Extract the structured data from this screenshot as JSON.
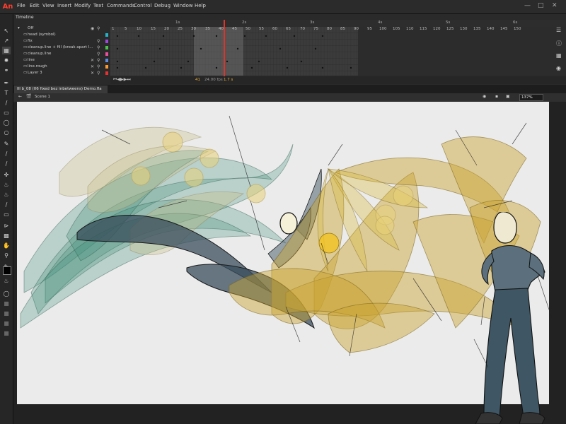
{
  "app": {
    "logo": "An"
  },
  "menu": [
    "File",
    "Edit",
    "View",
    "Insert",
    "Modify",
    "Text",
    "Commands",
    "Control",
    "Debug",
    "Window",
    "Help"
  ],
  "timeline": {
    "panel_title": "Timeline",
    "layers": [
      {
        "name": "Off"
      },
      {
        "name": "head (symbol)",
        "swatch": "#23b3c8"
      },
      {
        "name": "fix",
        "swatch": "#a046e0"
      },
      {
        "name": "cleanup.line + fill (break apart l...",
        "swatch": "#4cc34c"
      },
      {
        "name": "cleanup.line",
        "swatch": "#e84f9c"
      },
      {
        "name": "line",
        "swatch": "#5a8be0"
      },
      {
        "name": "line.rough",
        "swatch": "#ff9a2e"
      },
      {
        "name": "Layer 3",
        "swatch": "#e83030"
      }
    ],
    "frame_ticks": [
      "1",
      "5",
      "10",
      "15",
      "20",
      "25",
      "30",
      "35",
      "40",
      "45",
      "50",
      "55",
      "60",
      "65",
      "70",
      "75",
      "80",
      "85",
      "90",
      "95",
      "100",
      "105",
      "110",
      "115",
      "120",
      "125",
      "130",
      "135",
      "140",
      "145",
      "150"
    ],
    "second_marks": [
      "1s",
      "2s",
      "3s",
      "4s",
      "5s",
      "6s"
    ],
    "current_frame": "41",
    "fps": "24.00 fps",
    "time": "1.7 s"
  },
  "document": {
    "tab_title": "III b_08 (06 fixed bez inbetweens) Demo.fla",
    "scene": "Scene 1",
    "zoom": "137%"
  }
}
